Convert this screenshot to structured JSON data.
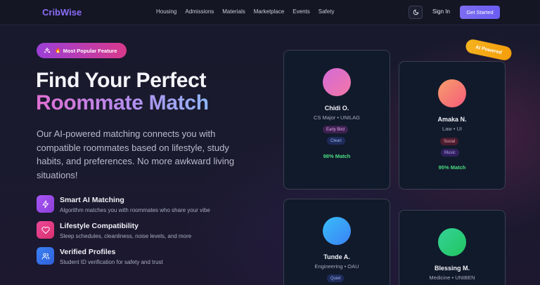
{
  "nav": {
    "logo": "CribWise",
    "links": [
      "Housing",
      "Admissions",
      "Materials",
      "Marketplace",
      "Events",
      "Safety"
    ],
    "sign_in": "Sign In",
    "get_started": "Get Started"
  },
  "hero": {
    "badge": "Most Popular Feature",
    "title_line1": "Find Your Perfect",
    "title_line2": "Roommate Match",
    "description": "Our AI-powered matching connects you with compatible roommates based on lifestyle, study habits, and preferences. No more awkward living situations!",
    "features": [
      {
        "title": "Smart AI Matching",
        "subtitle": "Algorithm matches you with roommates who share your vibe",
        "icon": "lightning-icon",
        "color": "#9b51e0"
      },
      {
        "title": "Lifestyle Compatibility",
        "subtitle": "Sleep schedules, cleanliness, noise levels, and more",
        "icon": "heart-icon",
        "color": "#e23b84"
      },
      {
        "title": "Verified Profiles",
        "subtitle": "Student ID verification for safety and trust",
        "icon": "users-icon",
        "color": "#3b6fe3"
      }
    ]
  },
  "ai_badge": "AI Powered",
  "cards": [
    {
      "name": "Chidi O.",
      "detail": "CS Major • UNILAG",
      "tags": [
        "Early Bird",
        "Clean"
      ],
      "match": "98% Match"
    },
    {
      "name": "Amaka N.",
      "detail": "Law • UI",
      "tags": [
        "Social",
        "Music"
      ],
      "match": "95% Match"
    },
    {
      "name": "Tunde A.",
      "detail": "Engineering • OAU",
      "tags": [
        "Quiet"
      ]
    },
    {
      "name": "Blessing M.",
      "detail": "Medicine • UNIBEN",
      "tags": []
    }
  ],
  "colors": {
    "brand": "#8b6cf6",
    "accent_gradient": [
      "#7c6cf0",
      "#6a5df2"
    ],
    "match_green": "#4ade80"
  }
}
